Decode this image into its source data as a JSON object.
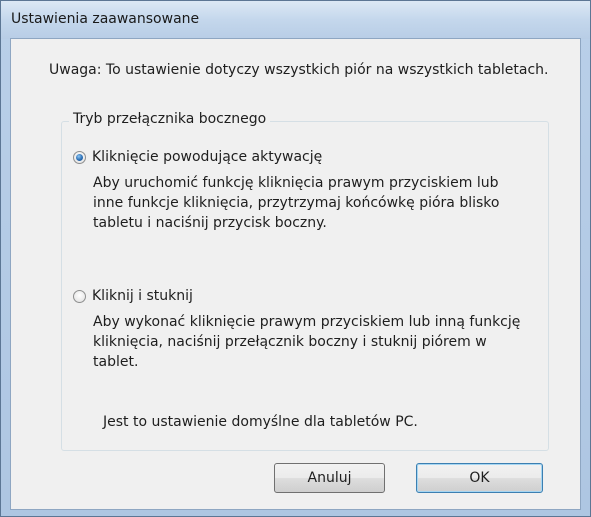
{
  "window": {
    "title": "Ustawienia zaawansowane"
  },
  "note": "Uwaga: To ustawienie dotyczy wszystkich piór na wszystkich tabletach.",
  "group": {
    "label": "Tryb przełącznika bocznego",
    "options": [
      {
        "label": "Kliknięcie powodujące aktywację",
        "selected": true,
        "description": "Aby uruchomić funkcję kliknięcia prawym przyciskiem lub inne funkcje kliknięcia, przytrzymaj końcówkę pióra blisko tabletu i naciśnij przycisk boczny."
      },
      {
        "label": "Kliknij i stuknij",
        "selected": false,
        "description": "Aby wykonać kliknięcie prawym przyciskiem lub inną funkcję kliknięcia, naciśnij przełącznik boczny i stuknij piórem w tablet."
      }
    ],
    "default_note": "Jest to ustawienie domyślne dla tabletów PC."
  },
  "buttons": {
    "cancel": "Anuluj",
    "ok": "OK"
  }
}
